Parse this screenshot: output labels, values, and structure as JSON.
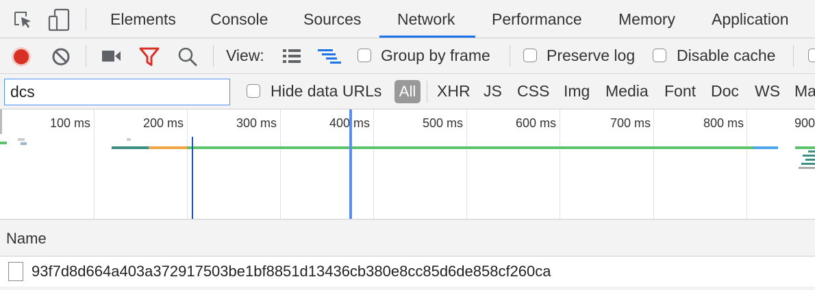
{
  "tabs": [
    "Elements",
    "Console",
    "Sources",
    "Network",
    "Performance",
    "Memory",
    "Application"
  ],
  "active_tab": "Network",
  "toolbar": {
    "view_label": "View:",
    "group_by_frame": "Group by frame",
    "preserve_log": "Preserve log",
    "disable_cache": "Disable cache"
  },
  "filter": {
    "value": "dcs",
    "hide_data_urls": "Hide data URLs",
    "types": [
      "All",
      "XHR",
      "JS",
      "CSS",
      "Img",
      "Media",
      "Font",
      "Doc",
      "WS",
      "Ma"
    ]
  },
  "timeline": {
    "ticks": [
      "100 ms",
      "200 ms",
      "300 ms",
      "400 ms",
      "500 ms",
      "600 ms",
      "700 ms",
      "800 ms",
      "900"
    ]
  },
  "table": {
    "name_header": "Name",
    "rows": [
      {
        "name": "93f7d8d664a403a372917503be1bf8851d13436cb380e8cc85d6de858cf260ca"
      }
    ]
  },
  "colors": {
    "accent": "#1a73e8",
    "record": "#d93025",
    "filter_icon": "#d93025",
    "waterfall_blue": "#5b9bef",
    "bar_green": "#5dc36b",
    "bar_teal": "#3d8f86",
    "bar_orange": "#f0a444",
    "bar_lightblue": "#4fa6ea"
  }
}
